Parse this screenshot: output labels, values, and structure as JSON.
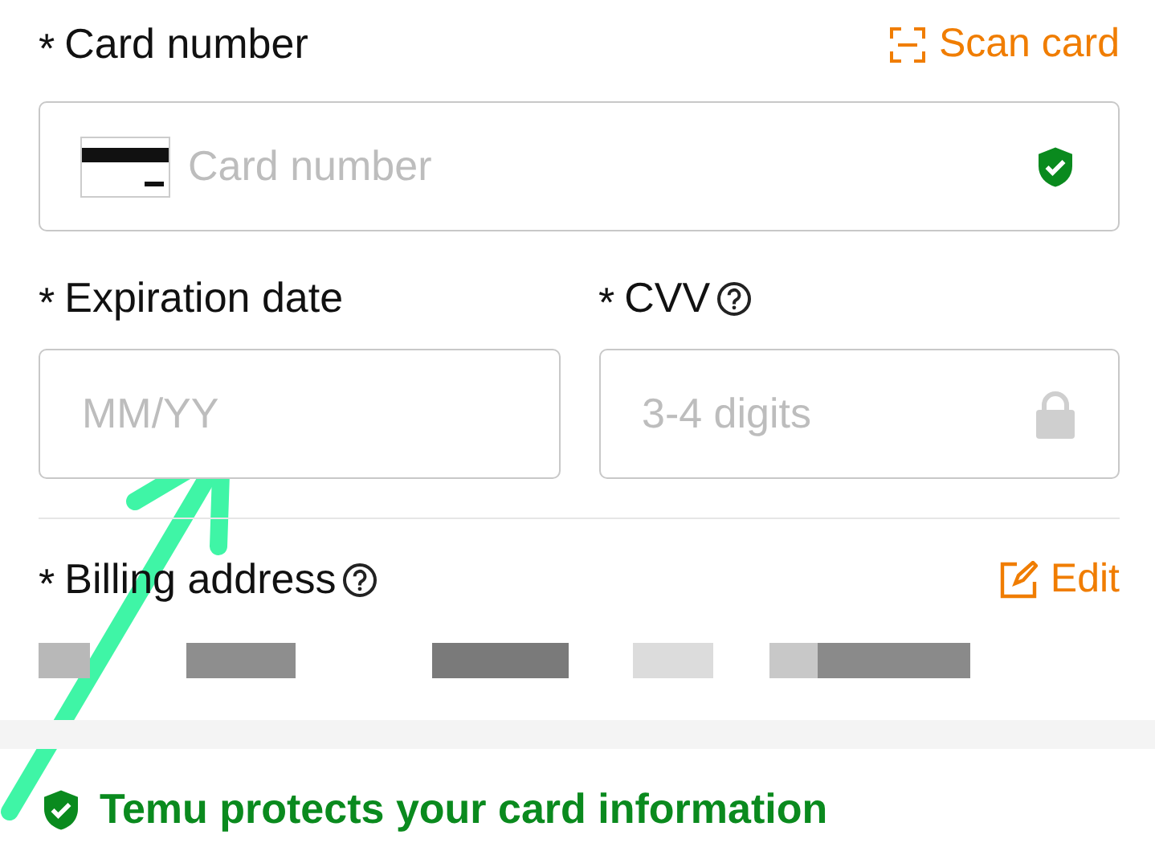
{
  "card_number": {
    "marker": "*",
    "label": "Card number",
    "scan_label": "Scan card",
    "placeholder": "Card number",
    "verified": true
  },
  "expiration": {
    "marker": "*",
    "label": "Expiration date",
    "placeholder": "MM/YY"
  },
  "cvv": {
    "marker": "*",
    "label": "CVV",
    "help": true,
    "placeholder": "3-4 digits",
    "locked": true
  },
  "billing": {
    "marker": "*",
    "label": "Billing address",
    "help": true,
    "edit_label": "Edit",
    "address_redacted": true
  },
  "notice": "Temu protects your card information"
}
